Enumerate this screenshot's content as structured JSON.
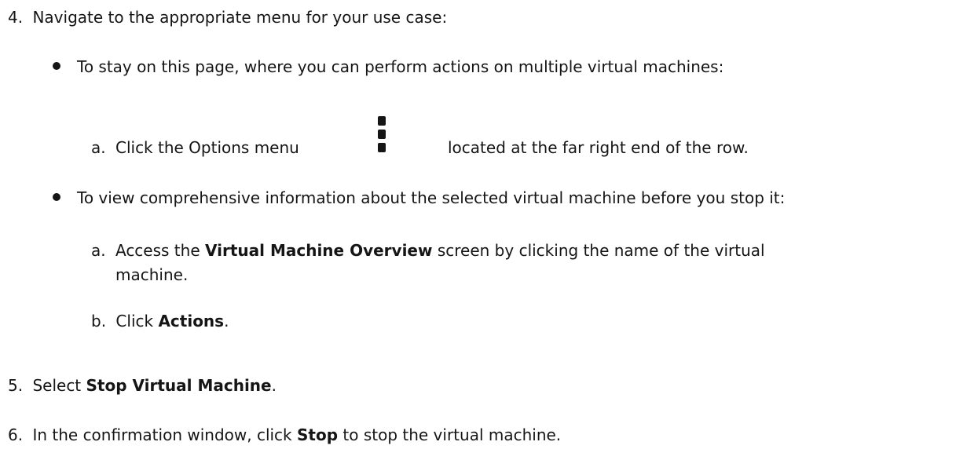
{
  "steps": {
    "s4": {
      "num": "4.",
      "text": "Navigate to the appropriate menu for your use case:"
    },
    "bullet1": {
      "text": "To stay on this page, where you can perform actions on multiple virtual machines:"
    },
    "sub_a1": {
      "num": "a.",
      "pre": "Click the Options menu",
      "post": "located at the far right end of the row."
    },
    "bullet2": {
      "text": "To view comprehensive information about the selected virtual machine before you stop it:"
    },
    "sub_a2": {
      "num": "a.",
      "pre": "Access the ",
      "bold": "Virtual Machine Overview",
      "post": "screen by clicking the name of the virtual",
      "cont": "machine."
    },
    "sub_b": {
      "num": "b.",
      "pre": "Click ",
      "bold": "Actions",
      "post": "."
    },
    "s5": {
      "num": "5.",
      "pre": "Select ",
      "bold": "Stop Virtual Machine",
      "post": "."
    },
    "s6": {
      "num": "6.",
      "pre": "In the confirmation window, click ",
      "bold": "Stop",
      "post": " to stop the virtual machine."
    }
  },
  "icons": {
    "options_menu": "kebab-vertical-icon"
  }
}
